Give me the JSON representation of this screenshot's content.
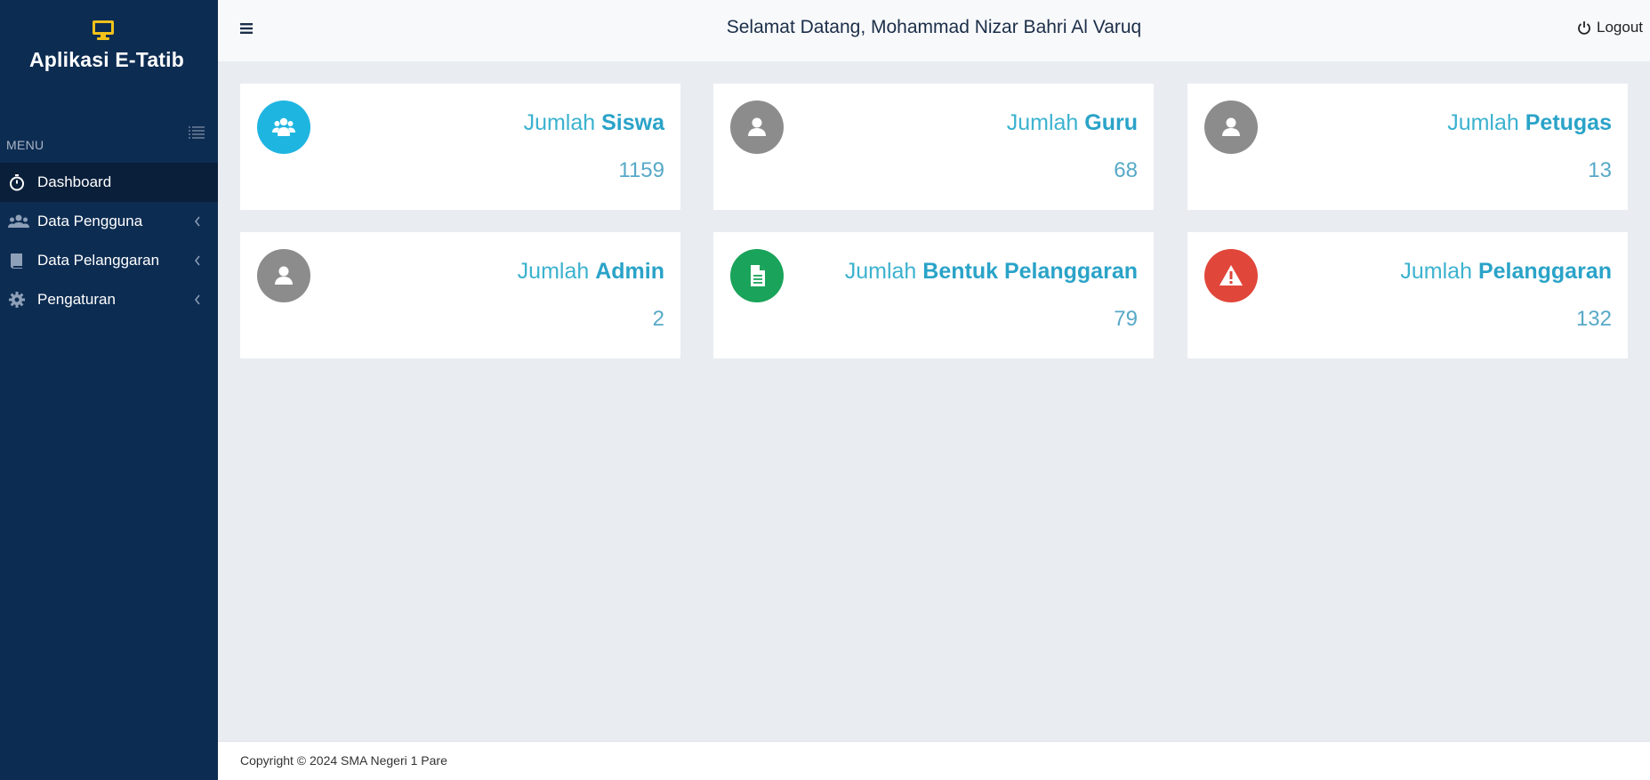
{
  "app": {
    "title": "Aplikasi E-Tatib",
    "brand_icon": "monitor-icon",
    "brand_icon_color": "#f2c21b",
    "sidebar_color": "#0d2c52"
  },
  "sidebar": {
    "menu_header": "MENU",
    "items": [
      {
        "label": "Dashboard",
        "icon": "stopwatch-icon",
        "active": true
      },
      {
        "label": "Data Pengguna",
        "icon": "users-icon",
        "has_submenu": true
      },
      {
        "label": "Data Pelanggaran",
        "icon": "book-icon",
        "has_submenu": true
      },
      {
        "label": "Pengaturan",
        "icon": "gear-icon",
        "has_submenu": true
      }
    ]
  },
  "topbar": {
    "welcome": "Selamat Datang, Mohammad Nizar Bahri Al Varuq",
    "logout_label": "Logout"
  },
  "cards": [
    {
      "prefix": "Jumlah",
      "label": "Siswa",
      "value": "1159",
      "icon": "users-icon",
      "color": "#1fb5e1"
    },
    {
      "prefix": "Jumlah",
      "label": "Guru",
      "value": "68",
      "icon": "user-icon",
      "color": "#8c8c8c"
    },
    {
      "prefix": "Jumlah",
      "label": "Petugas",
      "value": "13",
      "icon": "user-icon",
      "color": "#8c8c8c"
    },
    {
      "prefix": "Jumlah",
      "label": "Admin",
      "value": "2",
      "icon": "user-icon",
      "color": "#8c8c8c"
    },
    {
      "prefix": "Jumlah",
      "label": "Bentuk Pelanggaran",
      "value": "79",
      "icon": "document-icon",
      "color": "#1aa35a"
    },
    {
      "prefix": "Jumlah",
      "label": "Pelanggaran",
      "value": "132",
      "icon": "warning-icon",
      "color": "#e1463a"
    }
  ],
  "footer": {
    "text": "Copyright © 2024 SMA Negeri 1 Pare"
  }
}
